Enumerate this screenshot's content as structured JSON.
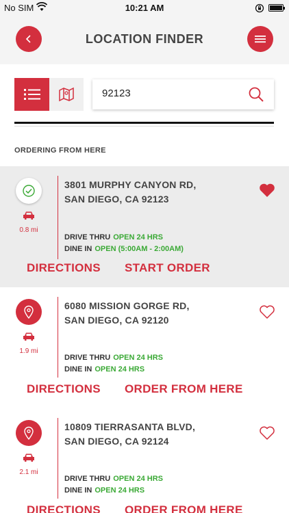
{
  "status_bar": {
    "carrier": "No SIM",
    "time": "10:21 AM"
  },
  "header": {
    "title": "LOCATION FINDER"
  },
  "search": {
    "value": "92123",
    "placeholder": ""
  },
  "section_label": "ORDERING FROM HERE",
  "locations": [
    {
      "address_line1": "3801 MURPHY CANYON RD,",
      "address_line2": "SAN DIEGO, CA 92123",
      "distance": "0.8 mi",
      "selected": true,
      "favorited": true,
      "hours": [
        {
          "label": "DRIVE THRU",
          "status": "OPEN 24 HRS"
        },
        {
          "label": "DINE IN",
          "status": "OPEN (5:00AM - 2:00AM)"
        }
      ],
      "actions": [
        "DIRECTIONS",
        "START ORDER"
      ]
    },
    {
      "address_line1": "6080 MISSION GORGE RD,",
      "address_line2": "SAN DIEGO, CA 92120",
      "distance": "1.9 mi",
      "selected": false,
      "favorited": false,
      "hours": [
        {
          "label": "DRIVE THRU",
          "status": "OPEN 24 HRS"
        },
        {
          "label": "DINE IN",
          "status": "OPEN 24 HRS"
        }
      ],
      "actions": [
        "DIRECTIONS",
        "ORDER FROM HERE"
      ]
    },
    {
      "address_line1": "10809 TIERRASANTA BLVD,",
      "address_line2": "SAN DIEGO, CA 92124",
      "distance": "2.1 mi",
      "selected": false,
      "favorited": false,
      "hours": [
        {
          "label": "DRIVE THRU",
          "status": "OPEN 24 HRS"
        },
        {
          "label": "DINE IN",
          "status": "OPEN 24 HRS"
        }
      ],
      "actions": [
        "DIRECTIONS",
        "ORDER FROM HERE"
      ]
    }
  ],
  "colors": {
    "accent": "#d32f3e",
    "open_green": "#3aa935",
    "selected_bg": "#ececec",
    "header_bg": "#f4f4f4"
  }
}
